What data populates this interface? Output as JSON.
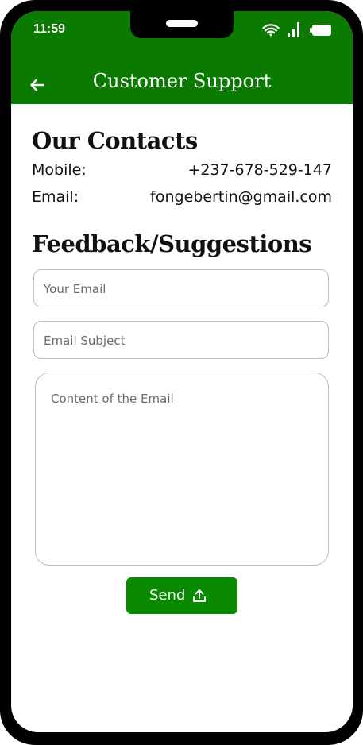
{
  "status_bar": {
    "time": "11:59",
    "icons": [
      "wifi-icon",
      "signal-icon",
      "battery-icon"
    ]
  },
  "app_bar": {
    "title": "Customer Support",
    "back_icon": "arrow-left-icon",
    "background": "#0a7a00"
  },
  "contacts": {
    "heading": "Our Contacts",
    "mobile_label": "Mobile:",
    "mobile_value": "+237-678-529-147",
    "email_label": "Email:",
    "email_value": "fongebertin@gmail.com"
  },
  "feedback": {
    "heading": "Feedback/Suggestions",
    "email_placeholder": "Your Email",
    "subject_placeholder": "Email Subject",
    "content_placeholder": "Content of the Email",
    "send_label": "Send",
    "send_icon": "upload-icon",
    "send_color": "#0a8a00"
  }
}
